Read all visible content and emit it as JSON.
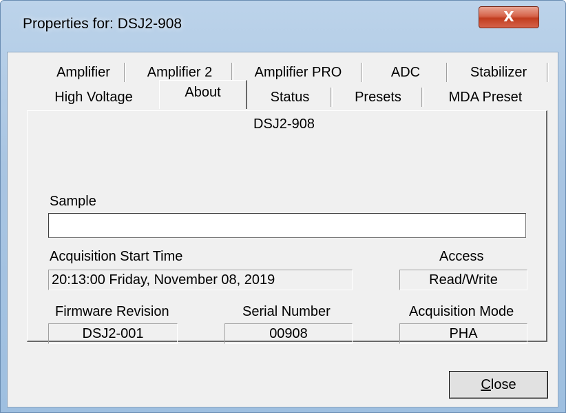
{
  "window": {
    "title": "Properties for: DSJ2-908",
    "close_glyph": "X"
  },
  "tabs": {
    "row1": [
      "Amplifier",
      "Amplifier 2",
      "Amplifier PRO",
      "ADC",
      "Stabilizer"
    ],
    "row2": [
      "High Voltage",
      "About",
      "Status",
      "Presets",
      "MDA Preset"
    ],
    "active": "About"
  },
  "about": {
    "device_name": "DSJ2-908",
    "sample_label": "Sample",
    "sample_value": "",
    "acq_start_label": "Acquisition Start Time",
    "acq_start_value": "20:13:00 Friday, November 08, 2019",
    "access_label": "Access",
    "access_value": "Read/Write",
    "firmware_label": "Firmware Revision",
    "firmware_value": "DSJ2-001",
    "serial_label": "Serial Number",
    "serial_value": "00908",
    "mode_label": "Acquisition Mode",
    "mode_value": "PHA"
  },
  "buttons": {
    "close_first": "C",
    "close_rest": "lose"
  }
}
